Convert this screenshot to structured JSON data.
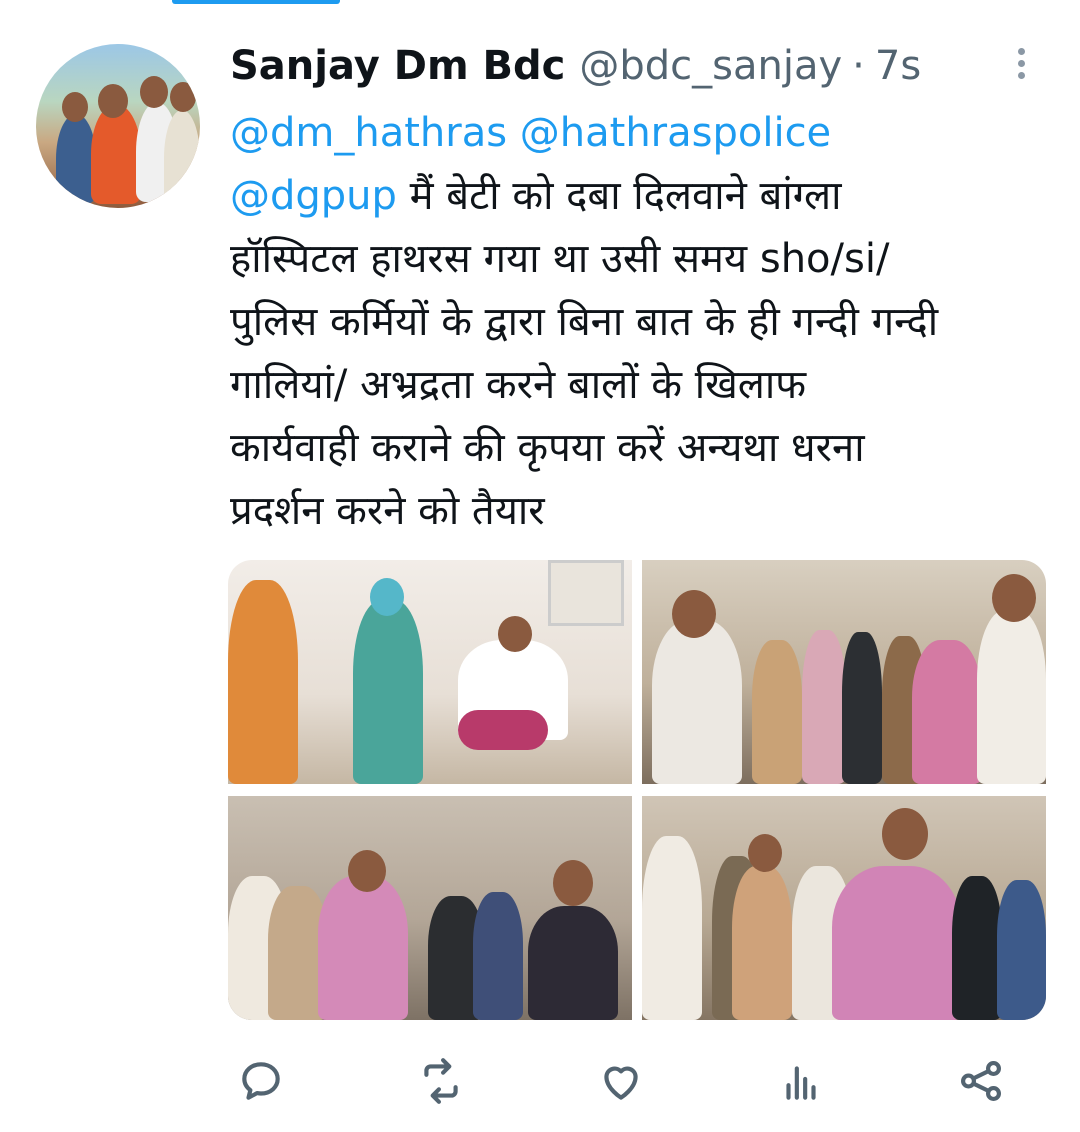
{
  "tweet": {
    "author_name": "Sanjay Dm Bdc",
    "handle": "@bdc_sanjay",
    "separator": "·",
    "time": "7s",
    "mentions": {
      "m1": "@dm_hathras",
      "m2": "@hathraspolice",
      "m3": "@dgpup"
    },
    "text_lines": {
      "line2_rest": " मैं बेटी को दबा दिलवाने बांग्ला",
      "line3": "हॉस्पिटल हाथरस गया था उसी समय sho/si/",
      "line4": "पुलिस कर्मियों के द्वारा बिना बात के ही गन्दी गन्दी",
      "line5": "गालियां/ अभ्रद्रता करने बालों के खिलाफ",
      "line6": "कार्यवाही कराने की कृपया करें अन्यथा धरना",
      "line7": "प्रदर्शन करने को तैयार"
    }
  },
  "icons": {
    "reply": "speech-bubble",
    "retweet": "retweet-arrows",
    "like": "heart",
    "views": "bar-chart",
    "share": "share-nodes"
  },
  "colors": {
    "accent": "#1d9bf0",
    "text": "#0f1419",
    "secondary": "#536471"
  }
}
